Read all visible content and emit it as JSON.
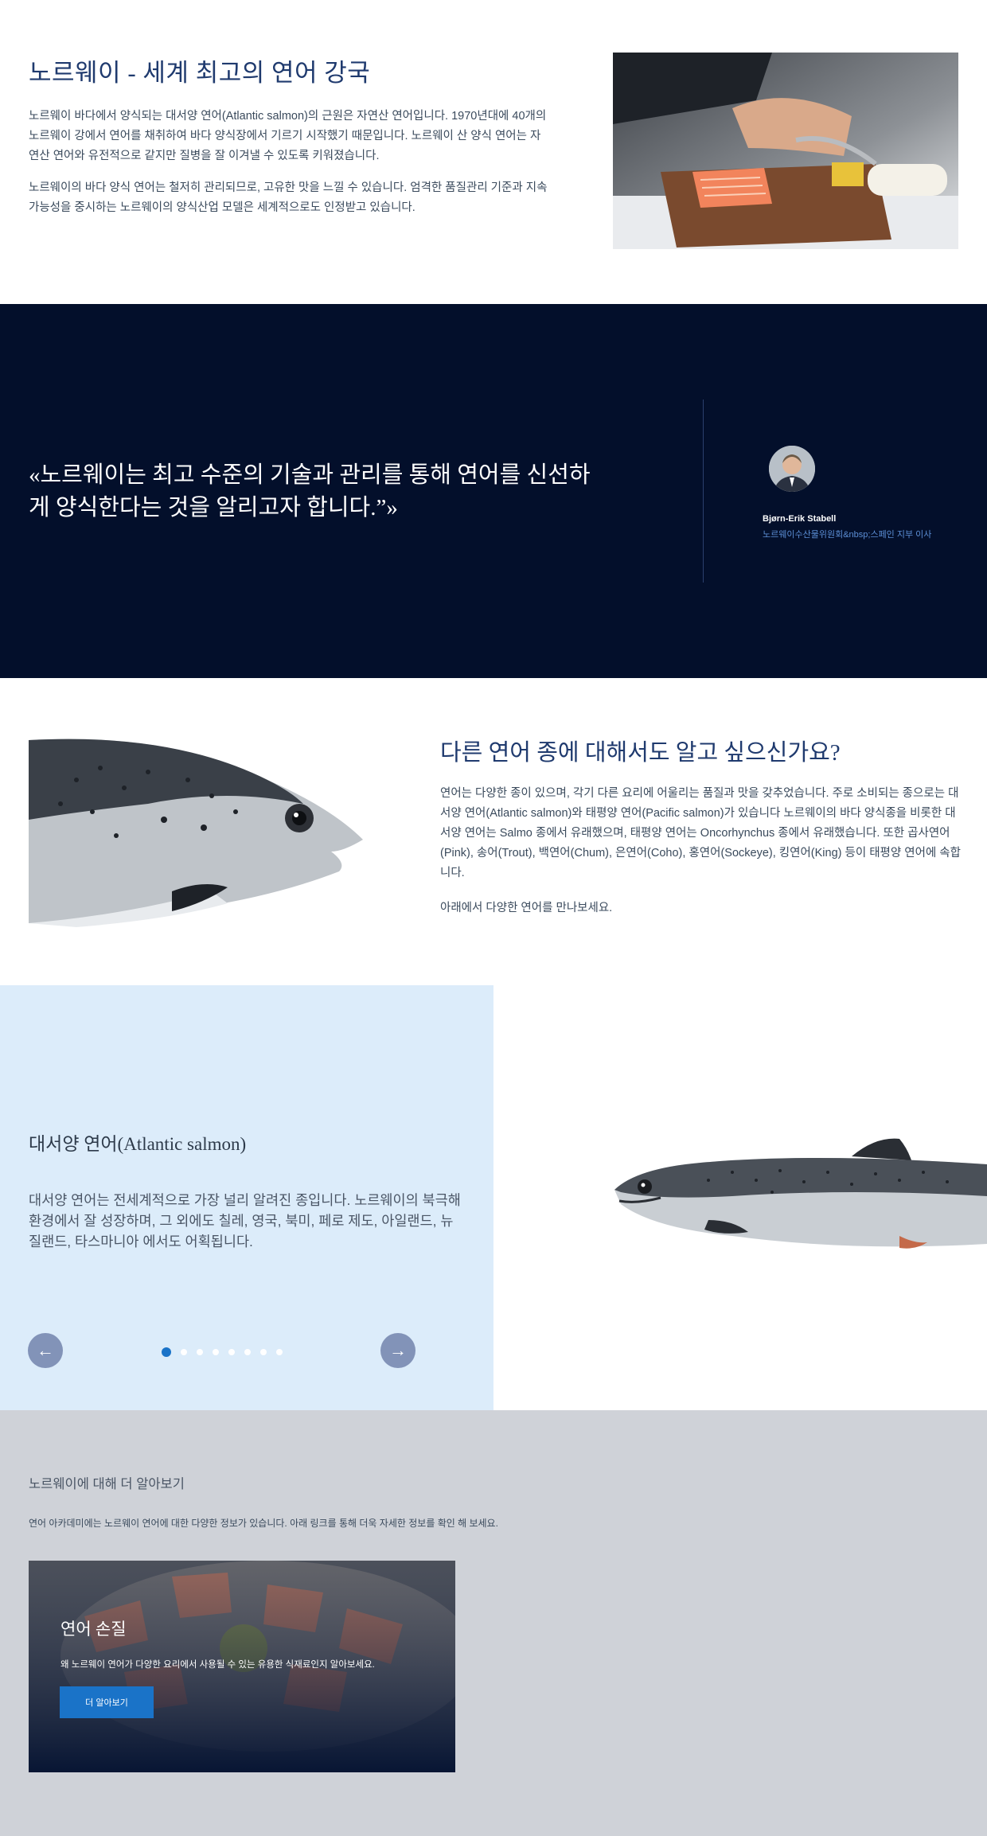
{
  "intro": {
    "title": "노르웨이 - 세계 최고의 연어 강국",
    "paragraph1": "노르웨이 바다에서 양식되는 대서양 연어(Atlantic salmon)의 근원은 자연산 연어입니다. 1970년대에 40개의 노르웨이 강에서 연어를 채취하여 바다 양식장에서 기르기 시작했기 때문입니다. 노르웨이 산 양식 연어는 자연산 연어와 유전적으로 같지만 질병을 잘 이겨낼 수 있도록 키워졌습니다.",
    "paragraph2": "노르웨이의 바다 양식 연어는 철저히 관리되므로, 고유한 맛을 느낄 수 있습니다. 엄격한 품질관리 기준과 지속 가능성을 중시하는 노르웨이의 양식산업 모델은 세계적으로도 인정받고 있습니다."
  },
  "quote": {
    "text": "«노르웨이는 최고 수준의 기술과 관리를 통해 연어를 신선하게 양식한다는 것을 알리고자 합니다.”»",
    "author": "Bjørn-Erik Stabell",
    "role": "노르웨이수산물위원회&nbsp;스페인 지부 이사"
  },
  "species": {
    "title": "다른 연어 종에 대해서도 알고 싶으신가요?",
    "paragraph1": "연어는 다양한 종이 있으며, 각기 다른 요리에 어울리는 품질과 맛을 갖추었습니다. 주로 소비되는 종으로는 대서양 연어(Atlantic salmon)와 태평양 연어(Pacific salmon)가 있습니다 노르웨이의 바다 양식종을 비롯한 대서양 연어는 Salmo 종에서 유래했으며, 태평양 연어는 Oncorhynchus 종에서 유래했습니다. 또한 곱사연어(Pink), 송어(Trout), 백연어(Chum), 은연어(Coho), 홍연어(Sockeye), 킹연어(King) 등이 태평양 연어에 속합니다.",
    "paragraph2": "아래에서 다양한 연어를 만나보세요."
  },
  "carousel": {
    "title": "대서양 연어(Atlantic salmon)",
    "description": "대서양 연어는 전세계적으로 가장 널리 알려진 종입니다. 노르웨이의 북극해 환경에서 잘 성장하며, 그 외에도 칠레, 영국, 북미, 페로 제도, 아일랜드, 뉴질랜드, 타스마니아 에서도 어획됩니다.",
    "prev_icon": "arrow-left-icon",
    "next_icon": "arrow-right-icon",
    "prev_glyph": "←",
    "next_glyph": "→",
    "slide_count": 8,
    "active_slide": 1
  },
  "learn": {
    "title": "노르웨이에 대해 더 알아보기",
    "intro": "연어 아카데미에는 노르웨이 연어에 대한 다양한 정보가 있습니다. 아래 링크를 통해 더욱 자세한 정보를 확인 해 보세요.",
    "card": {
      "title": "연어 손질",
      "text": "왜 노르웨이 연어가 다양한 요리에서 사용될 수 있는 유용한 식재료인지 알아보세요.",
      "button": "더 알아보기"
    }
  },
  "colors": {
    "navy": "#030f2b",
    "heading_blue": "#1f3a6e",
    "accent_blue": "#1a73c8",
    "light_blue_panel": "#dcecfa",
    "gray_section": "#cfd2d8"
  }
}
